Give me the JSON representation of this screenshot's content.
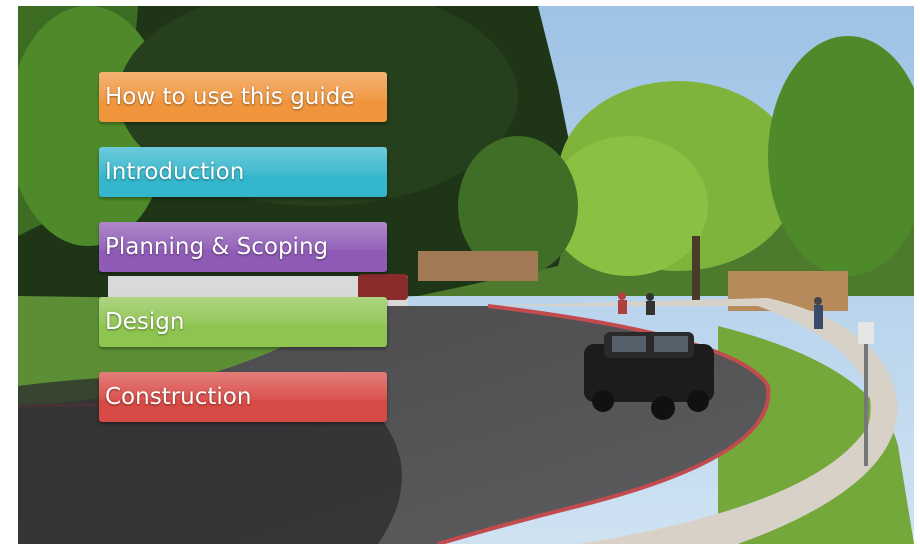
{
  "menu": {
    "items": [
      {
        "label": "How to use this guide",
        "color": "#f0953c"
      },
      {
        "label": "Introduction",
        "color": "#34b6cc"
      },
      {
        "label": "Planning & Scoping",
        "color": "#8f5bb6"
      },
      {
        "label": "Design",
        "color": "#8ec450"
      },
      {
        "label": "Construction",
        "color": "#d84a45"
      }
    ]
  },
  "scene": {
    "description_icon": "campus-roundabout-photo"
  }
}
